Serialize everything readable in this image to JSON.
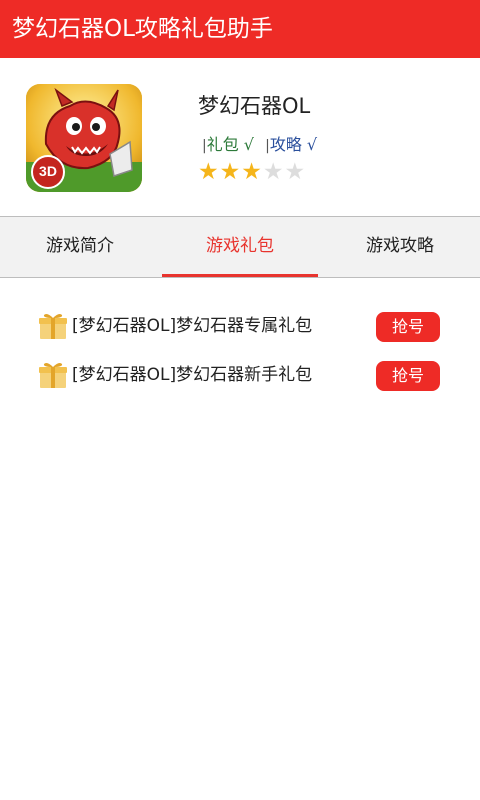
{
  "app": {
    "title": "梦幻石器OL攻略礼包助手"
  },
  "game": {
    "name": "梦幻石器OL",
    "icon": "game-dragon-3d-icon",
    "icon_badge": "3D",
    "tags": [
      {
        "bar": "|",
        "label": "礼包 √"
      },
      {
        "bar": "|",
        "label": "攻略 √"
      }
    ],
    "rating": 3,
    "rating_max": 5
  },
  "tabs": [
    {
      "label": "游戏简介",
      "active": false
    },
    {
      "label": "游戏礼包",
      "active": true
    },
    {
      "label": "游戏攻略",
      "active": false
    }
  ],
  "gifts": [
    {
      "icon": "gift-icon",
      "label": "[梦幻石器OL]梦幻石器专属礼包",
      "button": "抢号"
    },
    {
      "icon": "gift-icon",
      "label": "[梦幻石器OL]梦幻石器新手礼包",
      "button": "抢号"
    }
  ],
  "colors": {
    "brand_red": "#ee2b26",
    "star": "#f5b51b",
    "tag_gift": "#2d7a3a",
    "tag_guide": "#2a4f9c"
  }
}
